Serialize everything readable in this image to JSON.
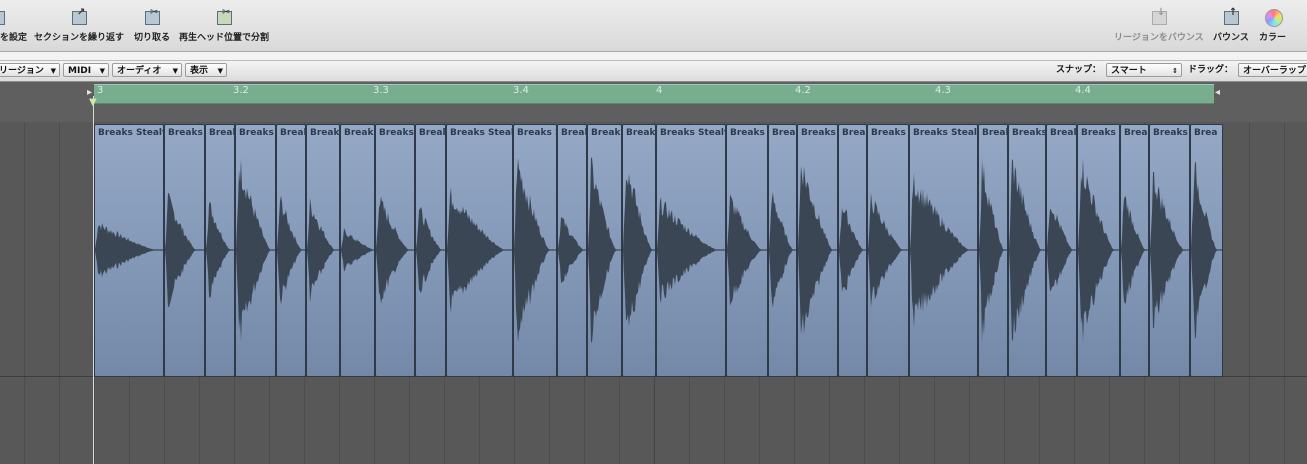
{
  "toolbar": {
    "left_cut_label": "を設定",
    "repeat_label": "セクションを繰り返す",
    "cut_label": "切り取る",
    "split_label": "再生ヘッド位置で分割",
    "bounce_region_label": "リージョンをバウンス",
    "bounce_label": "バウンス",
    "color_label": "カラー"
  },
  "menubar": {
    "region_menu": "リージョン",
    "midi_menu": "MIDI",
    "audio_menu": "オーディオ",
    "view_menu": "表示",
    "snap_label": "スナップ：",
    "snap_value": "スマート",
    "drag_label": "ドラッグ：",
    "drag_value": "オーバーラップ"
  },
  "ruler": {
    "labels": [
      "3",
      "3.2",
      "3.3",
      "3.4",
      "4",
      "4.2",
      "4.3",
      "4.4"
    ]
  },
  "region_name": "Breaks Stealth",
  "regions": [
    {
      "label": "Breaks Stealth",
      "peak": 0.28,
      "decay": 0.55
    },
    {
      "label": "Breaks",
      "peak": 0.55,
      "decay": 0.25
    },
    {
      "label": "Breal",
      "peak": 0.5,
      "decay": 0.3
    },
    {
      "label": "Breaks S",
      "peak": 0.95,
      "decay": 0.45
    },
    {
      "label": "Breal",
      "peak": 0.55,
      "decay": 0.35
    },
    {
      "label": "Breaks",
      "peak": 0.5,
      "decay": 0.35
    },
    {
      "label": "Breaks",
      "peak": 0.2,
      "decay": 0.6
    },
    {
      "label": "Breaks",
      "peak": 0.55,
      "decay": 0.4
    },
    {
      "label": "Breal",
      "peak": 0.45,
      "decay": 0.35
    },
    {
      "label": "Breaks Stealth",
      "peak": 0.6,
      "decay": 0.55
    },
    {
      "label": "Breaks S",
      "peak": 0.95,
      "decay": 0.4
    },
    {
      "label": "Breal",
      "peak": 0.35,
      "decay": 0.4
    },
    {
      "label": "Breaks",
      "peak": 0.9,
      "decay": 0.35
    },
    {
      "label": "Breaks",
      "peak": 0.95,
      "decay": 0.45
    },
    {
      "label": "Breaks Stealth",
      "peak": 0.5,
      "decay": 0.55
    },
    {
      "label": "Breaks S",
      "peak": 0.55,
      "decay": 0.4
    },
    {
      "label": "Breal",
      "peak": 0.6,
      "decay": 0.35
    },
    {
      "label": "Breaks",
      "peak": 0.95,
      "decay": 0.45
    },
    {
      "label": "Breal",
      "peak": 0.5,
      "decay": 0.35
    },
    {
      "label": "Breaks",
      "peak": 0.55,
      "decay": 0.4
    },
    {
      "label": "Breaks Stealth",
      "peak": 0.75,
      "decay": 0.55
    },
    {
      "label": "Breal",
      "peak": 0.9,
      "decay": 0.35
    },
    {
      "label": "Breaks",
      "peak": 0.95,
      "decay": 0.45
    },
    {
      "label": "Breal",
      "peak": 0.55,
      "decay": 0.35
    },
    {
      "label": "Breaks S",
      "peak": 0.95,
      "decay": 0.45
    },
    {
      "label": "Breal",
      "peak": 0.6,
      "decay": 0.35
    },
    {
      "label": "Breaks",
      "peak": 0.8,
      "decay": 0.4
    },
    {
      "label": "Brea",
      "peak": 0.9,
      "decay": 0.3
    }
  ],
  "colors": {
    "region_fill": "#8a9ebd",
    "waveform": "#3b4654",
    "cycle": "#79ad8f"
  }
}
